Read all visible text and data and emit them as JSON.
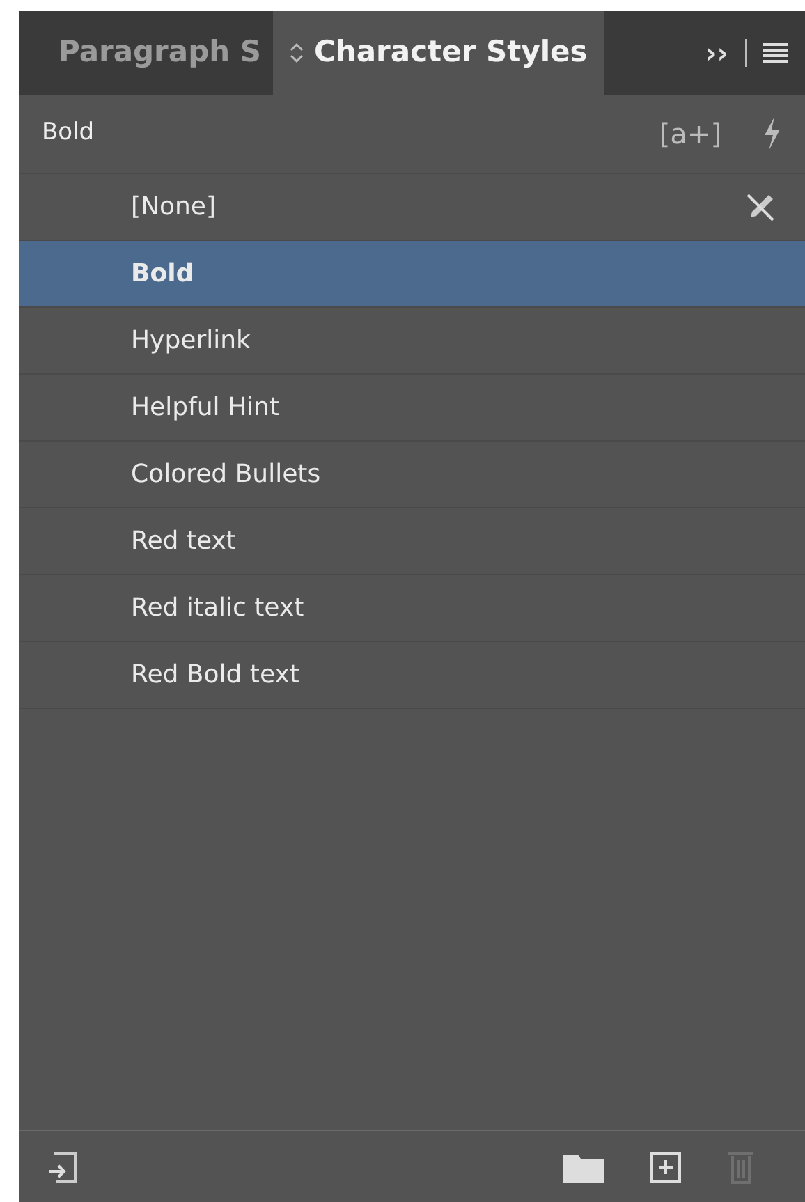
{
  "tabs": [
    {
      "label": "Paragraph S",
      "selected": false
    },
    {
      "label": "Character Styles",
      "selected": true
    }
  ],
  "tab_controls": {
    "expand": "››"
  },
  "header": {
    "current_style": "Bold",
    "new_style_label": "[a+]"
  },
  "styles": [
    {
      "name": "[None]",
      "selected": false,
      "kind": "none"
    },
    {
      "name": "Bold",
      "selected": true,
      "kind": "style"
    },
    {
      "name": "Hyperlink",
      "selected": false,
      "kind": "style"
    },
    {
      "name": "Helpful Hint",
      "selected": false,
      "kind": "style"
    },
    {
      "name": "Colored Bullets",
      "selected": false,
      "kind": "style"
    },
    {
      "name": "Red text",
      "selected": false,
      "kind": "style"
    },
    {
      "name": "Red italic text",
      "selected": false,
      "kind": "style"
    },
    {
      "name": "Red Bold text",
      "selected": false,
      "kind": "style"
    }
  ],
  "footer": {
    "delete_disabled": true
  }
}
